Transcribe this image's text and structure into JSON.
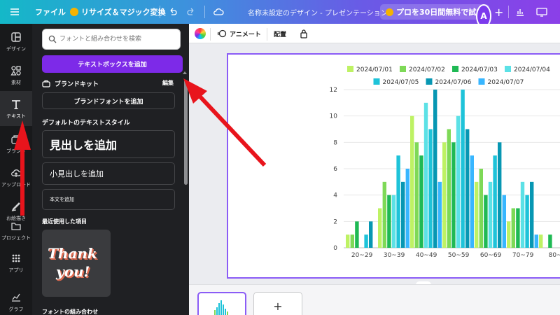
{
  "topbar": {
    "file_label": "ファイル",
    "resize_label": "リサイズ＆マジック変換",
    "doc_title": "名称未設定のデザイン - プレゼンテーション",
    "trial_label": "プロを30日間無料で試す",
    "avatar_letter": "A"
  },
  "rail": [
    {
      "label": "デザイン",
      "icon": "design-icon"
    },
    {
      "label": "素材",
      "icon": "elements-icon"
    },
    {
      "label": "テキスト",
      "icon": "text-icon"
    },
    {
      "label": "ブランド",
      "icon": "brand-icon"
    },
    {
      "label": "アップロード",
      "icon": "upload-icon"
    },
    {
      "label": "お絵描き",
      "icon": "draw-icon"
    },
    {
      "label": "プロジェクト",
      "icon": "folder-icon"
    },
    {
      "label": "アプリ",
      "icon": "apps-icon"
    },
    {
      "label": "グラフ",
      "icon": "chart-icon"
    }
  ],
  "panel": {
    "search_placeholder": "フォントと組み合わせを検索",
    "add_textbox": "テキストボックスを追加",
    "brand_kit": "ブランドキット",
    "edit": "編集",
    "add_brand_font": "ブランドフォントを追加",
    "default_styles": "デフォルトのテキストスタイル",
    "heading": "見出しを追加",
    "subheading": "小見出しを追加",
    "body": "本文を追加",
    "recent": "最近使用した項目",
    "thank_line1": "Thank",
    "thank_line2": "you!",
    "font_combos": "フォントの組み合わせ"
  },
  "toolbar": {
    "animate": "アニメート",
    "position": "配置"
  },
  "pages": {
    "add": "+"
  },
  "colors": {
    "accent": "#7d2ae8",
    "selection": "#8b5cf6",
    "arrow": "#e8141c"
  },
  "chart_data": {
    "type": "bar",
    "categories": [
      "20~29",
      "30~39",
      "40~49",
      "50~59",
      "60~69",
      "70~79",
      "80~"
    ],
    "ylim": [
      0,
      12
    ],
    "yticks": [
      0,
      2,
      4,
      6,
      8,
      10,
      12
    ],
    "legend_position": "top",
    "grid": true,
    "series": [
      {
        "name": "2024/07/01",
        "color": "#bef264",
        "values": [
          1,
          3,
          10,
          8,
          5,
          2,
          1
        ]
      },
      {
        "name": "2024/07/02",
        "color": "#7ed957",
        "values": [
          1,
          5,
          8,
          9,
          6,
          3,
          0
        ]
      },
      {
        "name": "2024/07/03",
        "color": "#1fb954",
        "values": [
          2,
          4,
          7,
          8,
          4,
          3,
          1
        ]
      },
      {
        "name": "2024/07/04",
        "color": "#5ce1e6",
        "values": [
          0,
          4,
          11,
          10,
          5,
          5,
          0
        ]
      },
      {
        "name": "2024/07/05",
        "color": "#1ec3d9",
        "values": [
          1,
          7,
          9,
          12,
          7,
          4,
          0
        ]
      },
      {
        "name": "2024/07/06",
        "color": "#0797b3",
        "values": [
          2,
          5,
          12,
          9,
          8,
          5,
          1
        ]
      },
      {
        "name": "2024/07/07",
        "color": "#38b6ff",
        "values": [
          0,
          6,
          5,
          7,
          4,
          1,
          2
        ]
      }
    ]
  }
}
